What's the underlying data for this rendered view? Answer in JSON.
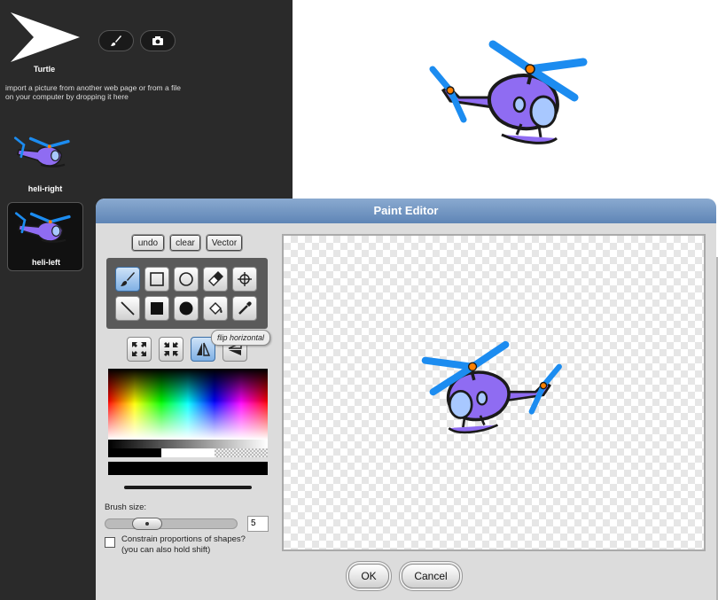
{
  "sprite": {
    "name": "Turtle",
    "paint_icon": "paintbrush-icon",
    "camera_icon": "camera-icon",
    "import_hint": "import a picture from another web page or from a file on your computer by dropping it here"
  },
  "costumes": [
    {
      "label": "heli-right",
      "selected": false
    },
    {
      "label": "heli-left",
      "selected": true
    }
  ],
  "paint_editor": {
    "title": "Paint Editor",
    "toolbar": {
      "undo": "undo",
      "clear": "clear",
      "vector": "Vector"
    },
    "tools": [
      {
        "name": "brush",
        "icon": "paintbrush-icon",
        "active": true
      },
      {
        "name": "rectangle",
        "icon": "rectangle-icon",
        "active": false
      },
      {
        "name": "ellipse",
        "icon": "ellipse-icon",
        "active": false
      },
      {
        "name": "eraser",
        "icon": "eraser-icon",
        "active": false
      },
      {
        "name": "rotation-center",
        "icon": "crosshair-icon",
        "active": false
      },
      {
        "name": "line",
        "icon": "line-icon",
        "active": false
      },
      {
        "name": "filled-rectangle",
        "icon": "filled-rectangle-icon",
        "active": false
      },
      {
        "name": "filled-ellipse",
        "icon": "filled-ellipse-icon",
        "active": false
      },
      {
        "name": "paint-bucket",
        "icon": "paint-bucket-icon",
        "active": false
      },
      {
        "name": "pipette",
        "icon": "pipette-icon",
        "active": false
      }
    ],
    "transforms": [
      {
        "name": "grow",
        "icon": "expand-icon"
      },
      {
        "name": "shrink",
        "icon": "shrink-icon"
      },
      {
        "name": "flip-horizontal",
        "icon": "flip-horizontal-icon",
        "active": true
      },
      {
        "name": "flip-vertical",
        "icon": "flip-vertical-icon"
      }
    ],
    "tooltip": "flip horizontal",
    "brush_size_label": "Brush size:",
    "brush_size_value": "5",
    "constrain_label": "Constrain proportions of shapes?",
    "constrain_hint": "(you can also hold shift)",
    "constrain_checked": false,
    "ok_label": "OK",
    "cancel_label": "Cancel"
  },
  "colors": {
    "accent": "#5f85b6",
    "heli_body": "#8f6cf2",
    "heli_rotor": "#1c8cf0",
    "heli_hub": "#ff8000"
  }
}
